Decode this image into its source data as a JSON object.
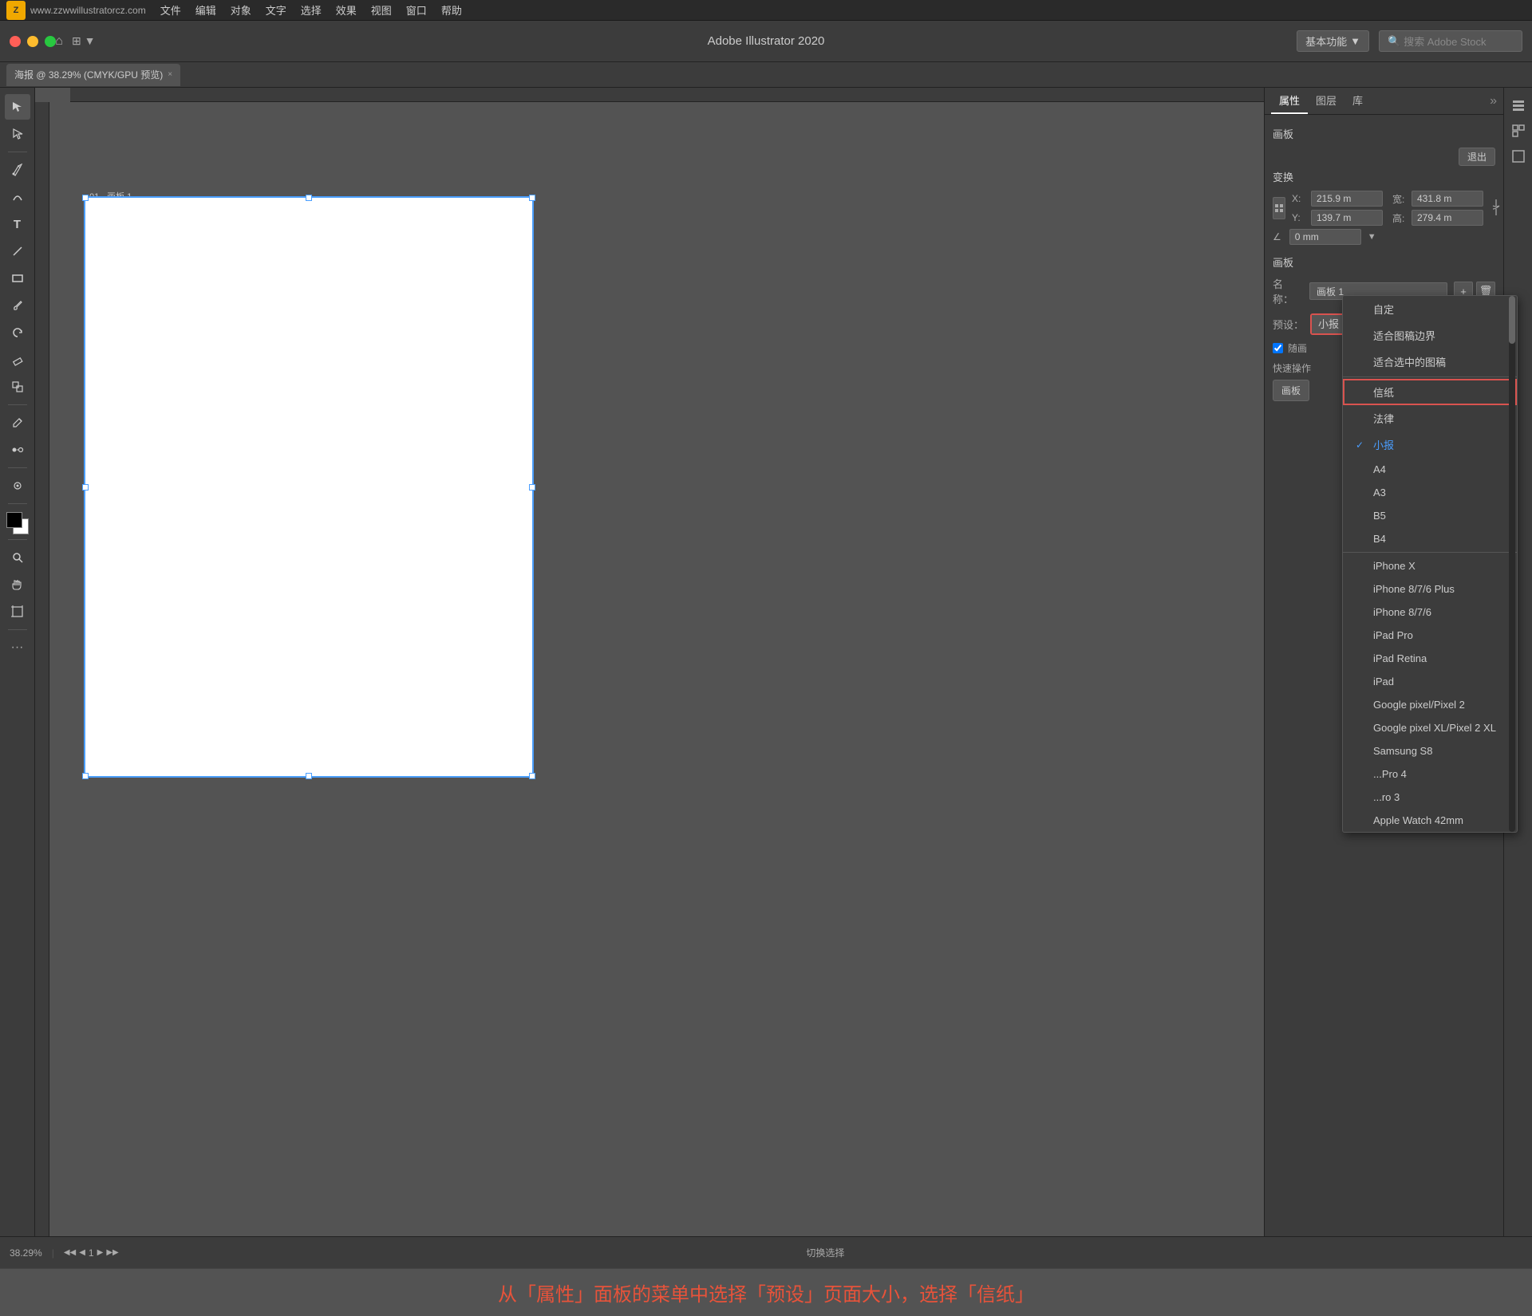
{
  "menubar": {
    "logo": "Z",
    "items": [
      "文件",
      "编辑",
      "对象",
      "文字",
      "选择",
      "效果",
      "视图",
      "窗口",
      "帮助"
    ]
  },
  "titlebar": {
    "title": "Adobe Illustrator 2020",
    "workspace": "基本功能",
    "search_placeholder": "搜索 Adobe Stock"
  },
  "tab": {
    "close": "×",
    "label": "海报 @ 38.29% (CMYK/GPU 预览)"
  },
  "panel": {
    "tabs": [
      "属性",
      "图层",
      "库"
    ],
    "more": "»",
    "artboard_section": "画板",
    "exit_btn": "退出",
    "transform_section": "变换",
    "x_label": "X:",
    "x_value": "215.9 m",
    "y_label": "Y:",
    "y_value": "139.7 m",
    "width_label": "宽:",
    "width_value": "431.8 m",
    "height_label": "高:",
    "height_value": "279.4 m",
    "angle_label": "∠",
    "angle_value": "0 mm",
    "artboard_name_label": "名称：",
    "artboard_name_value": "画板 1",
    "preset_label": "预设：",
    "preset_value": "小报",
    "checkbox_label": "随画",
    "quick_label": "快速操作",
    "quick_btn": "画板"
  },
  "dropdown": {
    "items": [
      {
        "label": "自定",
        "checked": false,
        "highlighted": false
      },
      {
        "label": "适合图稿边界",
        "checked": false,
        "highlighted": false
      },
      {
        "label": "适合选中的图稿",
        "checked": false,
        "highlighted": false
      },
      {
        "label": "信纸",
        "checked": false,
        "highlighted": true
      },
      {
        "label": "法律",
        "checked": false,
        "highlighted": false
      },
      {
        "label": "小报",
        "checked": true,
        "highlighted": false
      },
      {
        "label": "A4",
        "checked": false,
        "highlighted": false
      },
      {
        "label": "A3",
        "checked": false,
        "highlighted": false
      },
      {
        "label": "B5",
        "checked": false,
        "highlighted": false
      },
      {
        "label": "B4",
        "checked": false,
        "highlighted": false
      },
      {
        "label": "iPhone X",
        "checked": false,
        "highlighted": false
      },
      {
        "label": "iPhone 8/7/6 Plus",
        "checked": false,
        "highlighted": false
      },
      {
        "label": "iPhone 8/7/6",
        "checked": false,
        "highlighted": false
      },
      {
        "label": "iPad Pro",
        "checked": false,
        "highlighted": false
      },
      {
        "label": "iPad Retina",
        "checked": false,
        "highlighted": false
      },
      {
        "label": "iPad",
        "checked": false,
        "highlighted": false
      },
      {
        "label": "Google pixel/Pixel 2",
        "checked": false,
        "highlighted": false
      },
      {
        "label": "Google pixel XL/Pixel 2 XL",
        "checked": false,
        "highlighted": false
      },
      {
        "label": "Samsung S8",
        "checked": false,
        "highlighted": false
      },
      {
        "label": "...Pro 4",
        "checked": false,
        "highlighted": false
      },
      {
        "label": "...ro 3",
        "checked": false,
        "highlighted": false
      },
      {
        "label": "Apple Watch 42mm",
        "checked": false,
        "highlighted": false
      }
    ]
  },
  "artboard_label": "01 - 画板 1",
  "statusbar": {
    "zoom": "38.29%",
    "page": "1",
    "mode": "切换选择"
  },
  "instruction": "从「属性」面板的菜单中选择「预设」页面大小，选择「信纸」"
}
